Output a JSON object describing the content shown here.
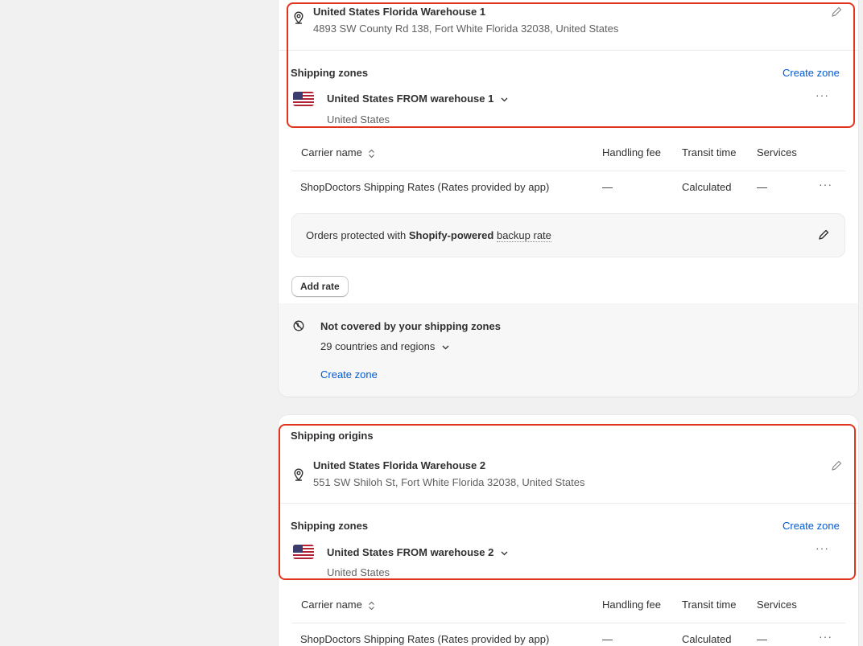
{
  "colors": {
    "accent_link": "#005bd3",
    "highlight_border": "#e0341f",
    "text": "#303030",
    "muted_text": "#616161"
  },
  "section1": {
    "origin": {
      "name": "United States Florida Warehouse 1",
      "address": "4893 SW County Rd 138, Fort White Florida 32038, United States",
      "icon": "location-pin-icon",
      "edit_icon": "pencil-icon"
    },
    "zones_title": "Shipping zones",
    "create_zone_label": "Create zone",
    "zone": {
      "name": "United States FROM warehouse 1",
      "country": "United States",
      "flag": "us-flag-icon",
      "more_label": "···"
    },
    "table": {
      "headers": [
        "Carrier name",
        "Handling fee",
        "Transit time",
        "Services"
      ],
      "row": {
        "carrier": "ShopDoctors Shipping Rates (Rates provided by app)",
        "handling_fee": "—",
        "transit_time": "Calculated",
        "services": "—",
        "more_label": "···"
      }
    },
    "backup": {
      "prefix": "Orders protected with ",
      "brand": "Shopify-powered",
      "suffix": "backup rate"
    },
    "add_rate_label": "Add rate",
    "not_covered": {
      "title": "Not covered by your shipping zones",
      "count_label": "29 countries and regions",
      "create_zone_label": "Create zone"
    }
  },
  "section2": {
    "origins_title": "Shipping origins",
    "origin": {
      "name": "United States Florida Warehouse 2",
      "address": "551 SW Shiloh St, Fort White Florida 32038, United States"
    },
    "zones_title": "Shipping zones",
    "create_zone_label": "Create zone",
    "zone": {
      "name": "United States FROM warehouse 2",
      "country": "United States",
      "more_label": "···"
    },
    "table": {
      "headers": [
        "Carrier name",
        "Handling fee",
        "Transit time",
        "Services"
      ],
      "row": {
        "carrier": "ShopDoctors Shipping Rates (Rates provided by app)",
        "handling_fee": "—",
        "transit_time": "Calculated",
        "services": "—",
        "more_label": "···"
      }
    }
  }
}
